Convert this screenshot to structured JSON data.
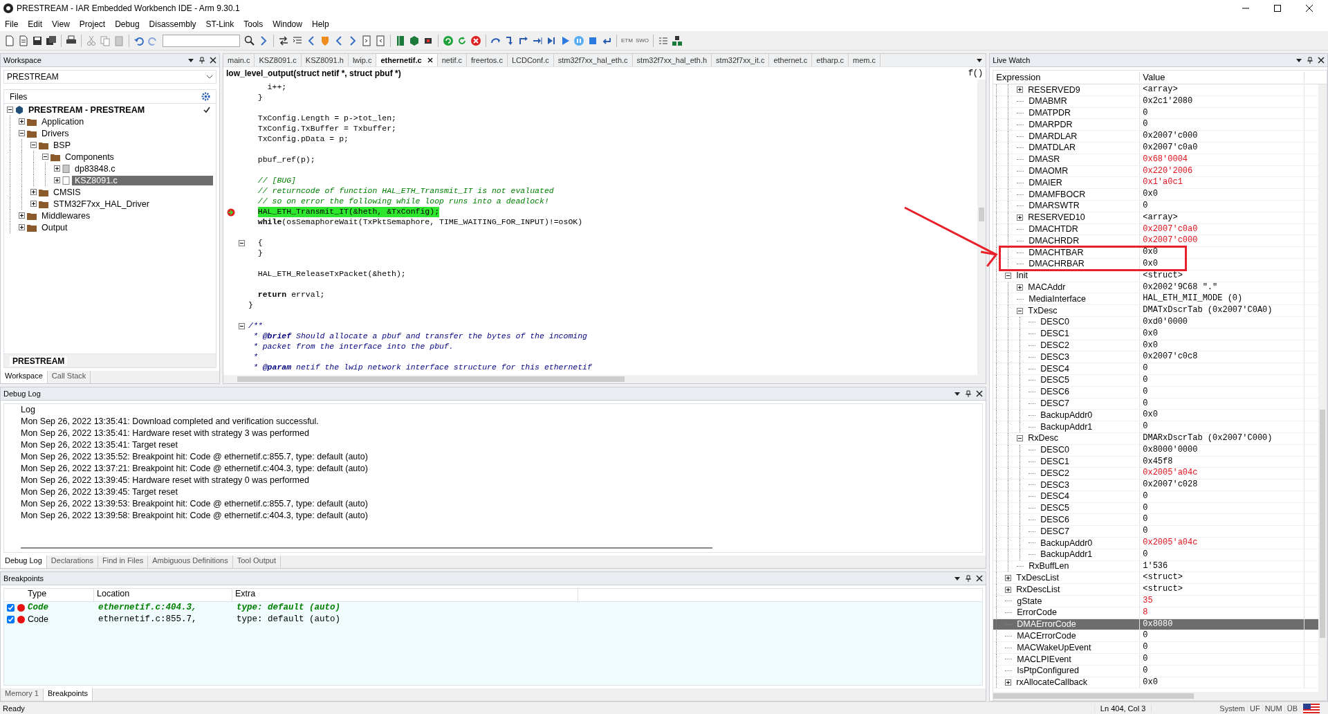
{
  "window": {
    "title": "PRESTREAM - IAR Embedded Workbench IDE - Arm 9.30.1"
  },
  "menu": [
    "File",
    "Edit",
    "View",
    "Project",
    "Debug",
    "Disassembly",
    "ST-Link",
    "Tools",
    "Window",
    "Help"
  ],
  "toolbar": {
    "labels": [
      "ETM",
      "SWO"
    ]
  },
  "workspace": {
    "title": "Workspace",
    "project_selector": "PRESTREAM",
    "files_header": "Files",
    "config_tab": "PRESTREAM",
    "tree": [
      {
        "label": "PRESTREAM - PRESTREAM",
        "kind": "project",
        "expanded": true,
        "selected": false,
        "checked": true,
        "children": [
          {
            "label": "Application",
            "kind": "folder",
            "expanded": false,
            "selected": false,
            "checked": false
          },
          {
            "label": "Drivers",
            "kind": "folder",
            "expanded": true,
            "selected": false,
            "checked": false,
            "children": [
              {
                "label": "BSP",
                "kind": "folder",
                "expanded": true,
                "selected": false,
                "checked": false,
                "children": [
                  {
                    "label": "Components",
                    "kind": "folder",
                    "expanded": true,
                    "selected": false,
                    "checked": false,
                    "children": [
                      {
                        "label": "dp83848.c",
                        "kind": "file",
                        "expanded": false,
                        "selected": false,
                        "checked": false
                      },
                      {
                        "label": "KSZ8091.c",
                        "kind": "file",
                        "expanded": false,
                        "selected": true,
                        "checked": false
                      }
                    ]
                  }
                ]
              },
              {
                "label": "CMSIS",
                "kind": "folder",
                "expanded": false,
                "selected": false,
                "checked": false
              },
              {
                "label": "STM32F7xx_HAL_Driver",
                "kind": "folder",
                "expanded": false,
                "selected": false,
                "checked": false
              }
            ]
          },
          {
            "label": "Middlewares",
            "kind": "folder",
            "expanded": false,
            "selected": false,
            "checked": false
          },
          {
            "label": "Output",
            "kind": "folder",
            "expanded": false,
            "selected": false,
            "checked": false
          }
        ]
      }
    ],
    "tabs": [
      {
        "label": "Workspace",
        "selected": true
      },
      {
        "label": "Call Stack",
        "selected": false
      }
    ]
  },
  "editor": {
    "tabs": [
      {
        "label": "main.c",
        "selected": false
      },
      {
        "label": "KSZ8091.c",
        "selected": false
      },
      {
        "label": "KSZ8091.h",
        "selected": false
      },
      {
        "label": "lwip.c",
        "selected": false
      },
      {
        "label": "ethernetif.c",
        "selected": true
      },
      {
        "label": "netif.c",
        "selected": false
      },
      {
        "label": "freertos.c",
        "selected": false
      },
      {
        "label": "LCDConf.c",
        "selected": false
      },
      {
        "label": "stm32f7xx_hal_eth.c",
        "selected": false
      },
      {
        "label": "stm32f7xx_hal_eth.h",
        "selected": false
      },
      {
        "label": "stm32f7xx_it.c",
        "selected": false
      },
      {
        "label": "ethernet.c",
        "selected": false
      },
      {
        "label": "etharp.c",
        "selected": false
      },
      {
        "label": "mem.c",
        "selected": false
      }
    ],
    "function": "low_level_output(struct netif *, struct pbuf *)",
    "function_button": "f()",
    "lines": [
      {
        "kind": "code",
        "text": "    i++;",
        "fold": false
      },
      {
        "kind": "code",
        "text": "  }",
        "fold": false
      },
      {
        "kind": "blank",
        "fold": false
      },
      {
        "kind": "code",
        "text": "  TxConfig.Length = p->tot_len;",
        "fold": false
      },
      {
        "kind": "code",
        "text": "  TxConfig.TxBuffer = Txbuffer;",
        "fold": false
      },
      {
        "kind": "code",
        "text": "  TxConfig.pData = p;",
        "fold": false
      },
      {
        "kind": "blank",
        "fold": false
      },
      {
        "kind": "code",
        "text": "  pbuf_ref(p);",
        "fold": false
      },
      {
        "kind": "blank",
        "fold": false
      },
      {
        "kind": "comment",
        "text": "  // [BUG]",
        "fold": false
      },
      {
        "kind": "comment",
        "text": "  // returncode of function HAL_ETH_Transmit_IT is not evaluated",
        "fold": false
      },
      {
        "kind": "comment",
        "text": "  // so on error the following while loop runs into a deadlock!",
        "fold": false
      },
      {
        "kind": "current",
        "text": "  HAL_ETH_Transmit_IT(&heth, &TxConfig);",
        "fold": false
      },
      {
        "kind": "code",
        "text": "  **while**(osSemaphoreWait(TxPktSemaphore, TIME_WAITING_FOR_INPUT)!=osOK)",
        "fold": false
      },
      {
        "kind": "blank",
        "fold": false
      },
      {
        "kind": "code",
        "text": "  {",
        "fold": true
      },
      {
        "kind": "code",
        "text": "  }",
        "fold": false
      },
      {
        "kind": "blank",
        "fold": false
      },
      {
        "kind": "code",
        "text": "  HAL_ETH_ReleaseTxPacket(&heth);",
        "fold": false
      },
      {
        "kind": "blank",
        "fold": false
      },
      {
        "kind": "code",
        "text": "  **return** errval;",
        "fold": false
      },
      {
        "kind": "code",
        "text": "}",
        "fold": false
      },
      {
        "kind": "blank",
        "fold": false
      },
      {
        "kind": "doc",
        "text": "/**",
        "fold": true
      },
      {
        "kind": "doc",
        "text": " * **@brief** Should allocate a pbuf and transfer the bytes of the incoming",
        "fold": false
      },
      {
        "kind": "doc",
        "text": " * packet from the interface into the pbuf.",
        "fold": false
      },
      {
        "kind": "doc",
        "text": " *",
        "fold": false
      },
      {
        "kind": "doc",
        "text": " * **@param** netif the lwip network interface structure for this ethernetif",
        "fold": false
      }
    ]
  },
  "debug_log": {
    "title": "Debug Log",
    "column": "Log",
    "lines": [
      "Mon Sep 26, 2022 13:35:41: Download completed and verification successful.",
      "Mon Sep 26, 2022 13:35:41: Hardware reset with strategy 3 was performed",
      "Mon Sep 26, 2022 13:35:41: Target reset",
      "Mon Sep 26, 2022 13:35:52: Breakpoint hit: Code @ ethernetif.c:855.7, type: default (auto)",
      "Mon Sep 26, 2022 13:37:21: Breakpoint hit: Code @ ethernetif.c:404.3, type: default (auto)",
      "Mon Sep 26, 2022 13:39:45: Hardware reset with strategy 0 was performed",
      "Mon Sep 26, 2022 13:39:45: Target reset",
      "Mon Sep 26, 2022 13:39:53: Breakpoint hit: Code @ ethernetif.c:855.7, type: default (auto)",
      "Mon Sep 26, 2022 13:39:58: Breakpoint hit: Code @ ethernetif.c:404.3, type: default (auto)"
    ],
    "tabs": [
      {
        "label": "Debug Log",
        "selected": true
      },
      {
        "label": "Declarations",
        "selected": false
      },
      {
        "label": "Find in Files",
        "selected": false
      },
      {
        "label": "Ambiguous Definitions",
        "selected": false
      },
      {
        "label": "Tool Output",
        "selected": false
      }
    ]
  },
  "breakpoints": {
    "title": "Breakpoints",
    "columns": [
      "Type",
      "Location",
      "Extra"
    ],
    "rows": [
      {
        "checked": true,
        "current": true,
        "type": "Code",
        "location": "ethernetif.c:404.3,",
        "extra": "type: default (auto)"
      },
      {
        "checked": true,
        "current": false,
        "type": "Code",
        "location": "ethernetif.c:855.7,",
        "extra": "type: default (auto)"
      }
    ],
    "tabs": [
      {
        "label": "Memory 1",
        "selected": false
      },
      {
        "label": "Breakpoints",
        "selected": true
      }
    ]
  },
  "live_watch": {
    "title": "Live Watch",
    "columns": [
      "Expression",
      "Value"
    ],
    "items": [
      {
        "children": [
          {
            "name": "RESERVED9",
            "value": "<array>",
            "expanded": false,
            "changed": false,
            "selected": false,
            "framed": false
          },
          {
            "name": "DMABMR",
            "value": "0x2c1'2080",
            "changed": false,
            "selected": false,
            "framed": false
          },
          {
            "name": "DMATPDR",
            "value": "0",
            "changed": false,
            "selected": false,
            "framed": false
          },
          {
            "name": "DMARPDR",
            "value": "0",
            "changed": false,
            "selected": false,
            "framed": false
          },
          {
            "name": "DMARDLAR",
            "value": "0x2007'c000",
            "changed": false,
            "selected": false,
            "framed": false
          },
          {
            "name": "DMATDLAR",
            "value": "0x2007'c0a0",
            "changed": false,
            "selected": false,
            "framed": false
          },
          {
            "name": "DMASR",
            "value": "0x68'0004",
            "changed": true,
            "selected": false,
            "framed": false
          },
          {
            "name": "DMAOMR",
            "value": "0x220'2006",
            "changed": true,
            "selected": false,
            "framed": false
          },
          {
            "name": "DMAIER",
            "value": "0x1'a0c1",
            "changed": true,
            "selected": false,
            "framed": false
          },
          {
            "name": "DMAMFBOCR",
            "value": "0x0",
            "changed": false,
            "selected": false,
            "framed": false
          },
          {
            "name": "DMARSWTR",
            "value": "0",
            "changed": false,
            "selected": false,
            "framed": false
          },
          {
            "name": "RESERVED10",
            "value": "<array>",
            "expanded": false,
            "changed": false,
            "selected": false,
            "framed": false
          },
          {
            "name": "DMACHTDR",
            "value": "0x2007'c0a0",
            "changed": true,
            "selected": false,
            "framed": false
          },
          {
            "name": "DMACHRDR",
            "value": "0x2007'c000",
            "changed": true,
            "selected": false,
            "framed": false
          },
          {
            "name": "DMACHTBAR",
            "value": "0x0",
            "changed": false,
            "selected": false,
            "framed": true
          },
          {
            "name": "DMACHRBAR",
            "value": "0x0",
            "changed": false,
            "selected": false,
            "framed": true
          }
        ]
      },
      {
        "name": "Init",
        "value": "<struct>",
        "expanded": true,
        "changed": false,
        "selected": false,
        "framed": false,
        "children": [
          {
            "name": "MACAddr",
            "value": "0x2002'9C68 \".\"",
            "expanded": false,
            "changed": false,
            "selected": false,
            "framed": false
          },
          {
            "name": "MediaInterface",
            "value": "HAL_ETH_MII_MODE (0)",
            "changed": false,
            "selected": false,
            "framed": false
          },
          {
            "name": "TxDesc",
            "value": "DMATxDscrTab (0x2007'C0A0)",
            "expanded": true,
            "changed": false,
            "selected": false,
            "framed": false,
            "children": [
              {
                "name": "DESC0",
                "value": "0xd0'0000",
                "changed": false,
                "selected": false,
                "framed": false
              },
              {
                "name": "DESC1",
                "value": "0x0",
                "changed": false,
                "selected": false,
                "framed": false
              },
              {
                "name": "DESC2",
                "value": "0x0",
                "changed": false,
                "selected": false,
                "framed": false
              },
              {
                "name": "DESC3",
                "value": "0x2007'c0c8",
                "changed": false,
                "selected": false,
                "framed": false
              },
              {
                "name": "DESC4",
                "value": "0",
                "changed": false,
                "selected": false,
                "framed": false
              },
              {
                "name": "DESC5",
                "value": "0",
                "changed": false,
                "selected": false,
                "framed": false
              },
              {
                "name": "DESC6",
                "value": "0",
                "changed": false,
                "selected": false,
                "framed": false
              },
              {
                "name": "DESC7",
                "value": "0",
                "changed": false,
                "selected": false,
                "framed": false
              },
              {
                "name": "BackupAddr0",
                "value": "0x0",
                "changed": false,
                "selected": false,
                "framed": false
              },
              {
                "name": "BackupAddr1",
                "value": "0",
                "changed": false,
                "selected": false,
                "framed": false
              }
            ]
          },
          {
            "name": "RxDesc",
            "value": "DMARxDscrTab (0x2007'C000)",
            "expanded": true,
            "changed": false,
            "selected": false,
            "framed": false,
            "children": [
              {
                "name": "DESC0",
                "value": "0x8000'0000",
                "changed": false,
                "selected": false,
                "framed": false
              },
              {
                "name": "DESC1",
                "value": "0x45f8",
                "changed": false,
                "selected": false,
                "framed": false
              },
              {
                "name": "DESC2",
                "value": "0x2005'a04c",
                "changed": true,
                "selected": false,
                "framed": false
              },
              {
                "name": "DESC3",
                "value": "0x2007'c028",
                "changed": false,
                "selected": false,
                "framed": false
              },
              {
                "name": "DESC4",
                "value": "0",
                "changed": false,
                "selected": false,
                "framed": false
              },
              {
                "name": "DESC5",
                "value": "0",
                "changed": false,
                "selected": false,
                "framed": false
              },
              {
                "name": "DESC6",
                "value": "0",
                "changed": false,
                "selected": false,
                "framed": false
              },
              {
                "name": "DESC7",
                "value": "0",
                "changed": false,
                "selected": false,
                "framed": false
              },
              {
                "name": "BackupAddr0",
                "value": "0x2005'a04c",
                "changed": true,
                "selected": false,
                "framed": false
              },
              {
                "name": "BackupAddr1",
                "value": "0",
                "changed": false,
                "selected": false,
                "framed": false
              }
            ]
          },
          {
            "name": "RxBuffLen",
            "value": "1'536",
            "changed": false,
            "selected": false,
            "framed": false
          }
        ]
      },
      {
        "name": "TxDescList",
        "value": "<struct>",
        "expanded": false,
        "changed": false,
        "selected": false,
        "framed": false
      },
      {
        "name": "RxDescList",
        "value": "<struct>",
        "expanded": false,
        "changed": false,
        "selected": false,
        "framed": false
      },
      {
        "name": "gState",
        "value": "35",
        "changed": true,
        "selected": false,
        "framed": false
      },
      {
        "name": "ErrorCode",
        "value": "8",
        "changed": true,
        "selected": false,
        "framed": false
      },
      {
        "name": "DMAErrorCode",
        "value": "0x8080",
        "changed": false,
        "selected": true,
        "framed": false
      },
      {
        "name": "MACErrorCode",
        "value": "0",
        "changed": false,
        "selected": false,
        "framed": false
      },
      {
        "name": "MACWakeUpEvent",
        "value": "0",
        "changed": false,
        "selected": false,
        "framed": false
      },
      {
        "name": "MACLPIEvent",
        "value": "0",
        "changed": false,
        "selected": false,
        "framed": false
      },
      {
        "name": "IsPtpConfigured",
        "value": "0",
        "changed": false,
        "selected": false,
        "framed": false
      },
      {
        "name": "rxAllocateCallback",
        "value": "0x0",
        "expanded": false,
        "changed": false,
        "selected": false,
        "framed": false
      }
    ]
  },
  "status_bar": {
    "text": "Ready",
    "position": "Ln 404, Col 3",
    "indicators": [
      "System",
      "UF",
      "NUM",
      "ÜB"
    ]
  }
}
